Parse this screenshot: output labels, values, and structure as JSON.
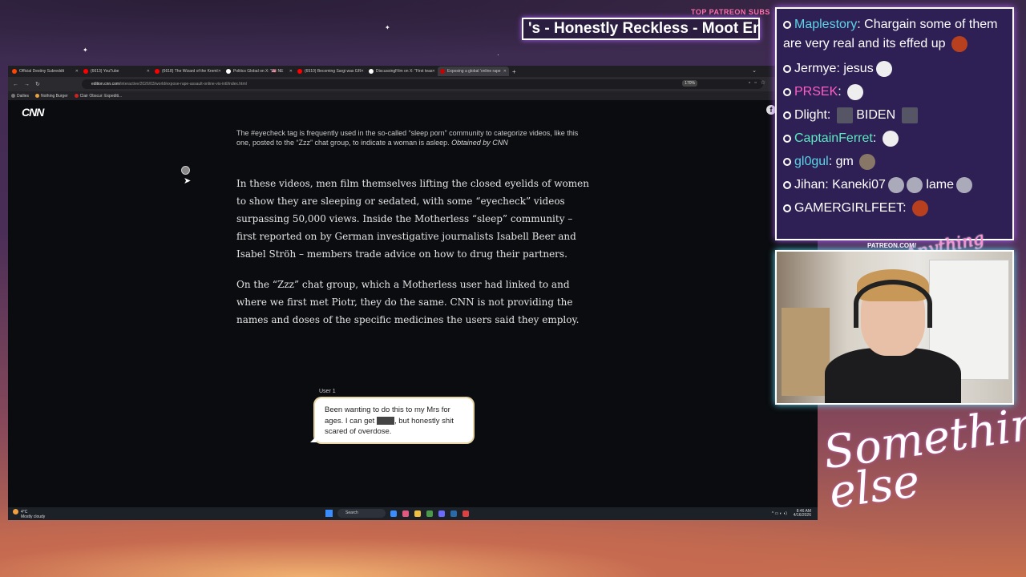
{
  "overlay": {
    "patreon_label": "TOP PATREON SUBS",
    "marquee_text": "'s - Honestly Reckless - Moot Enj",
    "patreon_url": "PATREON.COM/",
    "anything_else": "Anything else",
    "something_else": "Something else"
  },
  "browser": {
    "tabs": [
      {
        "label": "Official Destiny Subreddit",
        "color": "#ff4500"
      },
      {
        "label": "(6613) YouTube",
        "color": "#ff0000"
      },
      {
        "label": "(6618) The Wizard of the Kreml",
        "color": "#ff0000"
      },
      {
        "label": "Politics Global on X: \"🇺🇸 NE",
        "color": "#ffffff"
      },
      {
        "label": "(6510) Becoming Sargi was GR",
        "color": "#ff0000"
      },
      {
        "label": "DiscussingFilm on X: \"First teas",
        "color": "#ffffff"
      },
      {
        "label": "Exposing a global 'online rape",
        "color": "#cc0000",
        "active": true
      }
    ],
    "new_tab": "+",
    "url_domain": "edition.cnn.com",
    "url_path": "/interactive/2026/03/world/expose-rape-assault-online-vis-intl/index.html",
    "zoom": "170%",
    "bookmarks": [
      {
        "label": "Dailies",
        "color": "#777777"
      },
      {
        "label": "Nothing Burger",
        "color": "#e8a040"
      },
      {
        "label": "Clair Obscur: Expediti...",
        "color": "#cc2222"
      }
    ]
  },
  "article": {
    "logo": "CNN",
    "caption": "The #eyecheck tag is frequently used in the so-called “sleep porn” community to categorize videos, like this one, posted to the “Zzz” chat group, to indicate a woman is asleep.",
    "caption_credit": "Obtained by CNN",
    "paragraph1": "In these videos, men film themselves lifting the closed eyelids of women to show they are sleeping or sedated, with some “eyecheck” videos surpassing 50,000 views. Inside the Motherless “sleep” community – first reported on by German investigative journalists Isabell Beer and Isabel Ströh – members trade advice on how to drug their partners.",
    "paragraph2": "On the “Zzz” chat group, which a Motherless user had linked to and where we first met Piotr, they do the same. CNN is not providing the names and doses of the specific medicines the users said they employ.",
    "chat_user": "User 1",
    "chat_part1": "Been wanting to do this to my Mrs for ages. I can get",
    "chat_part2": ", but honestly shit scared of overdose."
  },
  "taskbar": {
    "temp": "4°C",
    "weather": "Mostly cloudy",
    "search": "Search",
    "time": "8:46 AM",
    "date": "4/16/2026"
  },
  "chat": {
    "messages": [
      {
        "user": "Maplestory",
        "text": "Chargain some of them are very real and its effed up",
        "color": "#5ad6e8"
      },
      {
        "user": "Jermye",
        "text": "jesus",
        "color": "#ffffff"
      },
      {
        "user": "PRSEK",
        "text": "",
        "color": "#ff5fc4"
      },
      {
        "user": "Dlight",
        "text": "BIDEN",
        "color": "#ffffff"
      },
      {
        "user": "CaptainFerret",
        "text": "",
        "color": "#5aeac0"
      },
      {
        "user": "gl0gul",
        "text": "gm",
        "color": "#5ad6e8"
      },
      {
        "user": "Jihan",
        "text": "Kaneki07",
        "text2": "lame",
        "color": "#ffffff"
      },
      {
        "user": "GAMERGIRLFEET",
        "text": "",
        "color": "#ffffff"
      }
    ]
  }
}
